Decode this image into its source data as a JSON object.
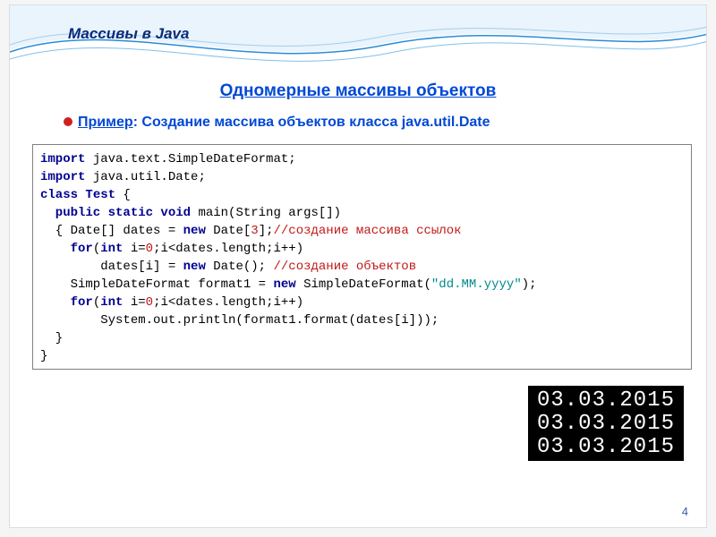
{
  "slide_title": "Массивы в Java",
  "section_title": "Одномерные массивы объектов",
  "example": {
    "label": "Пример",
    "colon": ": ",
    "text": "Создание массива объектов класса java.util.Date"
  },
  "code": {
    "l1_a": "import",
    "l1_b": " java.text.SimpleDateFormat;",
    "l2_a": "import",
    "l2_b": " java.util.Date;",
    "l3_a": "class",
    "l3_b": " Test",
    "l3_c": " {",
    "l4_a": "  public",
    "l4_b": " static",
    "l4_c": " void",
    "l4_d": " main(String args[])",
    "l5_a": "  { Date[] dates = ",
    "l5_b": "new",
    "l5_c": " Date[",
    "l5_d": "3",
    "l5_e": "];",
    "l5_f": "//создание массива ссылок",
    "l6_a": "    for",
    "l6_b": "(",
    "l6_c": "int",
    "l6_d": " i=",
    "l6_e": "0",
    "l6_f": ";i<dates.length;i++)",
    "l7_a": "        dates[i] = ",
    "l7_b": "new",
    "l7_c": " Date(); ",
    "l7_d": "//создание объектов",
    "l8_a": "    SimpleDateFormat format1 = ",
    "l8_b": "new",
    "l8_c": " SimpleDateFormat(",
    "l8_d": "\"dd.MM.yyyy\"",
    "l8_e": ");",
    "l9_a": "    for",
    "l9_b": "(",
    "l9_c": "int",
    "l9_d": " i=",
    "l9_e": "0",
    "l9_f": ";i<dates.length;i++)",
    "l10": "        System.out.println(format1.format(dates[i]));",
    "l11": "  }",
    "l12": "}"
  },
  "output": [
    "03.03.2015",
    "03.03.2015",
    "03.03.2015"
  ],
  "page_number": "4"
}
